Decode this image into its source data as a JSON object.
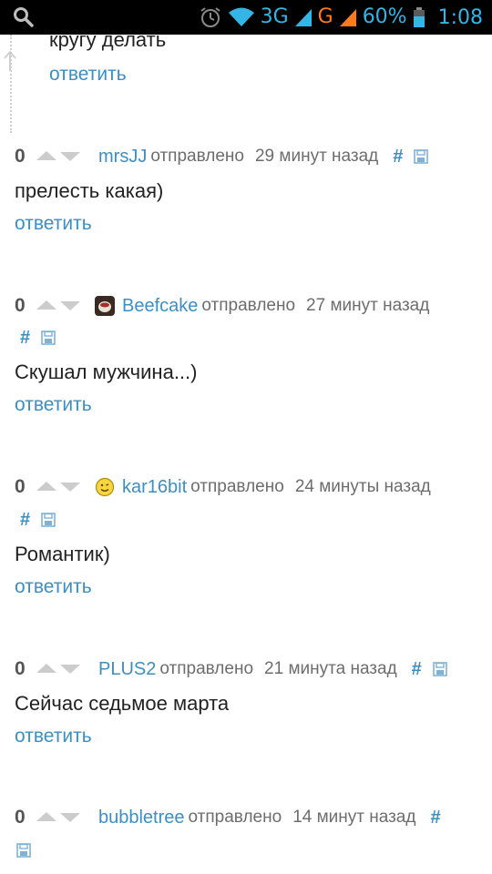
{
  "status_bar": {
    "network_3g": "3G",
    "network_g": "G",
    "battery": "60%",
    "time": "1:08",
    "accent_color": "#33b5e5"
  },
  "partial_comment": {
    "text": "кругу делать",
    "reply": "ответить"
  },
  "comments": [
    {
      "score": "0",
      "user": "mrsJJ",
      "sent": "отправлено",
      "time": "29 минут назад",
      "hash": "#",
      "text": "прелесть какая)",
      "reply": "ответить"
    },
    {
      "score": "0",
      "avatar": "cup-avatar-icon",
      "user": "Beefcake",
      "sent": "отправлено",
      "time": "27 минут назад",
      "hash": "#",
      "text": "Скушал мужчина...)",
      "reply": "ответить"
    },
    {
      "score": "0",
      "avatar": "smiley-avatar-icon",
      "user": "kar16bit",
      "sent": "отправлено",
      "time": "24 минуты назад",
      "hash": "#",
      "text": "Романтик)",
      "reply": "ответить"
    },
    {
      "score": "0",
      "user": "PLUS2",
      "sent": "отправлено",
      "time": "21 минута назад",
      "hash": "#",
      "text": "Сейчас седьмое марта",
      "reply": "ответить"
    },
    {
      "score": "0",
      "user": "bubbletree",
      "sent": "отправлено",
      "time": "14 минут назад",
      "hash": "#"
    }
  ]
}
